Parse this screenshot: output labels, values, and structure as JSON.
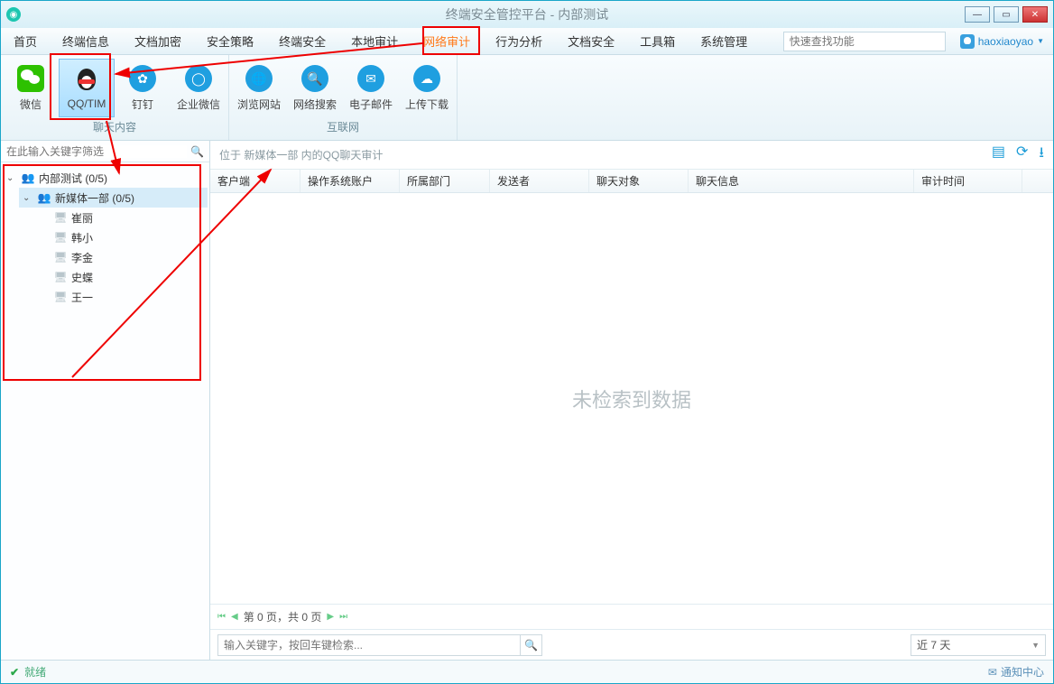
{
  "window": {
    "title": "终端安全管控平台 - 内部测试"
  },
  "menu": {
    "tabs": [
      "首页",
      "终端信息",
      "文档加密",
      "安全策略",
      "终端安全",
      "本地审计",
      "网络审计",
      "行为分析",
      "文档安全",
      "工具箱",
      "系统管理"
    ],
    "active_index": 6,
    "search_placeholder": "快速查找功能",
    "username": "haoxiaoyao"
  },
  "ribbon": {
    "groups": [
      {
        "label": "聊天内容",
        "items": [
          {
            "key": "wechat",
            "label": "微信"
          },
          {
            "key": "qqtim",
            "label": "QQ/TIM",
            "selected": true
          },
          {
            "key": "dingding",
            "label": "钉钉"
          },
          {
            "key": "wework",
            "label": "企业微信"
          }
        ]
      },
      {
        "label": "互联网",
        "items": [
          {
            "key": "browse",
            "label": "浏览网站"
          },
          {
            "key": "websearch",
            "label": "网络搜索"
          },
          {
            "key": "email",
            "label": "电子邮件"
          },
          {
            "key": "upload",
            "label": "上传下载"
          }
        ]
      }
    ]
  },
  "sidebar": {
    "filter_placeholder": "在此输入关键字筛选",
    "root": {
      "label": "内部测试 (0/5)",
      "expanded": true
    },
    "dept": {
      "label": "新媒体一部 (0/5)",
      "expanded": true,
      "selected": true
    },
    "users": [
      "崔丽",
      "韩小",
      "李金",
      "史蝶",
      "王一"
    ]
  },
  "main": {
    "breadcrumb": "位于 新媒体一部 内的QQ聊天审计",
    "columns": [
      "客户端",
      "操作系统账户",
      "所属部门",
      "发送者",
      "聊天对象",
      "聊天信息",
      "审计时间"
    ],
    "empty_text": "未检索到数据",
    "pager_text": "第 0 页，共 0 页",
    "keyword_placeholder": "输入关键字，按回车键检索...",
    "range_label": "近 7 天"
  },
  "status": {
    "text": "就绪",
    "notify": "通知中心"
  }
}
